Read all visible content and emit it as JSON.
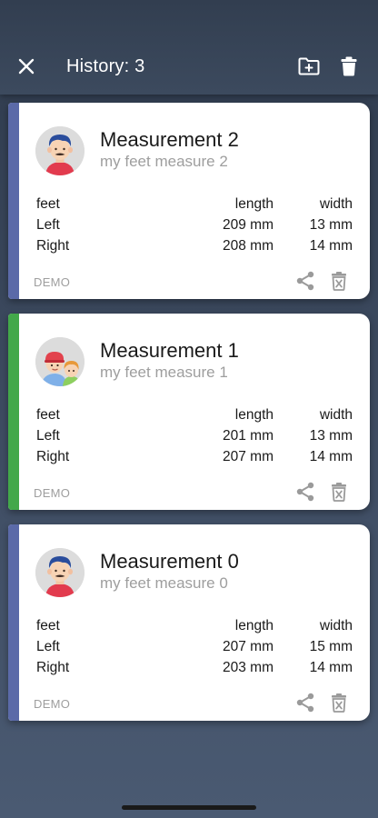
{
  "app_bar": {
    "title": "History: 3",
    "icons": [
      "close-icon",
      "folder-add-icon",
      "trash-icon"
    ],
    "color": "#ffffff"
  },
  "measurements": [
    {
      "title": "Measurement 2",
      "subtitle": "my feet measure 2",
      "accent": "#5b6aa8",
      "avatar": "man-avatar-icon",
      "headers": [
        "feet",
        "length",
        "width"
      ],
      "rows": [
        {
          "label": "Left",
          "length": "209 mm",
          "width": "13 mm"
        },
        {
          "label": "Right",
          "length": "208 mm",
          "width": "14 mm"
        }
      ],
      "tag": "DEMO"
    },
    {
      "title": "Measurement 1",
      "subtitle": "my feet measure 1",
      "accent": "#43a84a",
      "avatar": "children-avatar-icon",
      "headers": [
        "feet",
        "length",
        "width"
      ],
      "rows": [
        {
          "label": "Left",
          "length": "201 mm",
          "width": "13 mm"
        },
        {
          "label": "Right",
          "length": "207 mm",
          "width": "14 mm"
        }
      ],
      "tag": "DEMO"
    },
    {
      "title": "Measurement 0",
      "subtitle": "my feet measure 0",
      "accent": "#5b6aa8",
      "avatar": "man-avatar-icon",
      "headers": [
        "feet",
        "length",
        "width"
      ],
      "rows": [
        {
          "label": "Left",
          "length": "207 mm",
          "width": "15 mm"
        },
        {
          "label": "Right",
          "length": "203 mm",
          "width": "14 mm"
        }
      ],
      "tag": "DEMO"
    }
  ]
}
